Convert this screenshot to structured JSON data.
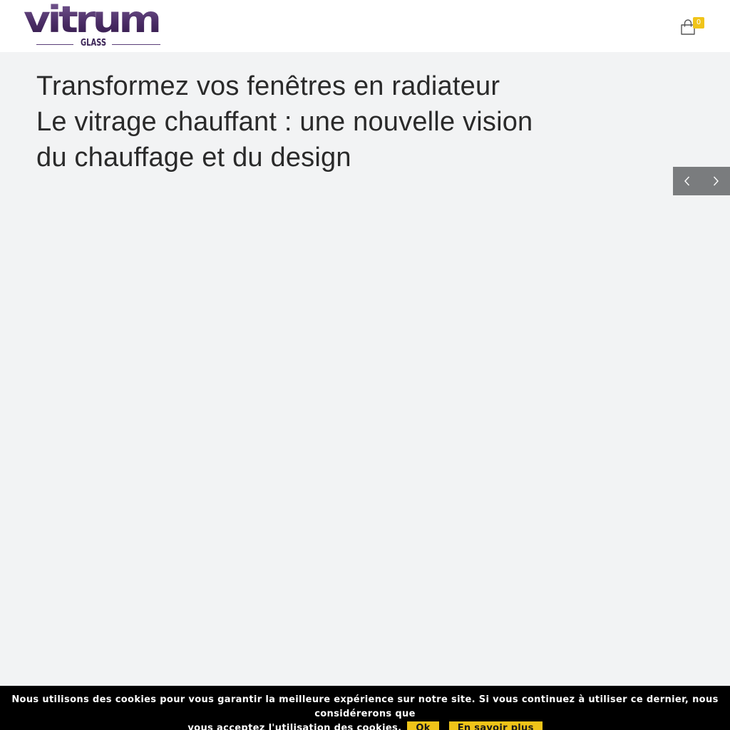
{
  "header": {
    "logo": {
      "brand": "vitrum",
      "sub": "GLASS"
    },
    "cart": {
      "count": "0",
      "icon": "shopping-bag-icon"
    }
  },
  "hero": {
    "lines": [
      "Transformez vos fenêtres en radiateur",
      "Le vitrage chauffant : une nouvelle vision",
      "du chauffage et du design"
    ]
  },
  "slider": {
    "prev_icon": "chevron-left-icon",
    "next_icon": "chevron-right-icon"
  },
  "cookie_bar": {
    "text_line1": "Nous utilisons des cookies pour vous garantir la meilleure expérience sur notre site. Si vous continuez à utiliser ce dernier, nous considérerons que",
    "text_line2": "vous acceptez l'utilisation des cookies.",
    "ok_label": "Ok",
    "more_label": "En savoir plus"
  },
  "colors": {
    "brand_purple": "#4b2d66",
    "accent_yellow": "#f0c419",
    "hero_background": "#f2f3f4",
    "slider_nav_bg": "#7a7c7e"
  }
}
